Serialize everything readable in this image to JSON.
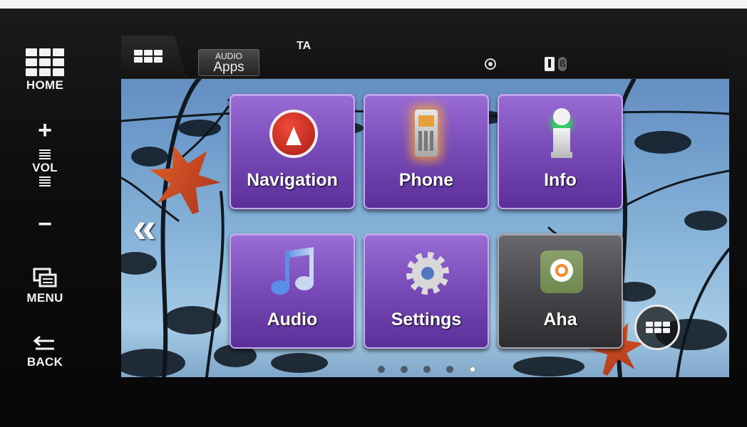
{
  "hard_buttons": {
    "home_label": "HOME",
    "vol_plus": "+",
    "vol_label": "VOL",
    "vol_minus": "−",
    "menu_label": "MENU",
    "back_label": "BACK"
  },
  "status_bar": {
    "source_top": "AUDIO",
    "source_bottom": "Apps",
    "ta_label": "TA",
    "icons": [
      "grid-icon",
      "gps-icon",
      "usb-icon",
      "bluetooth-icon"
    ]
  },
  "tiles": [
    {
      "label": "Navigation",
      "icon": "navigation-icon"
    },
    {
      "label": "Phone",
      "icon": "phone-icon"
    },
    {
      "label": "Info",
      "icon": "info-icon"
    },
    {
      "label": "Audio",
      "icon": "music-note-icon"
    },
    {
      "label": "Settings",
      "icon": "gear-icon"
    },
    {
      "label": "Aha",
      "icon": "aha-icon"
    }
  ],
  "pagination": {
    "count": 5,
    "active": 5
  },
  "colors": {
    "tile_purple": "#7a4db9",
    "tile_dark": "#4a4a4e",
    "accent_orange": "#e2612a"
  }
}
